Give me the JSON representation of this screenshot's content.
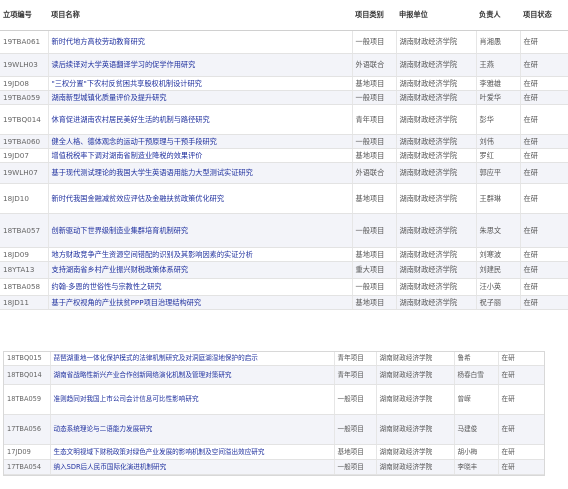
{
  "headers": {
    "id": "立项编号",
    "name": "项目名称",
    "type": "项目类别",
    "unit": "申报单位",
    "person": "负责人",
    "status": "项目状态"
  },
  "rows_main": [
    {
      "id": "19TBA061",
      "name": "新时代地方高校劳动教育研究",
      "type": "一般项目",
      "unit": "湖南财政经济学院",
      "person": "肖湘愚",
      "status": "在研"
    },
    {
      "id": "19WLH03",
      "name": "读后续译对大学英语翻译学习的促学作用研究",
      "type": "外语联合",
      "unit": "湖南财政经济学院",
      "person": "王燕",
      "status": "在研"
    },
    {
      "id": "19JD08",
      "name": "\"三权分置\"下农村反贫困共享股权机制设计研究",
      "type": "基地项目",
      "unit": "湖南财政经济学院",
      "person": "李雅雄",
      "status": "在研"
    },
    {
      "id": "19TBA059",
      "name": "湖南新型城镇化质量评价及提升研究",
      "type": "一般项目",
      "unit": "湖南财政经济学院",
      "person": "叶爱华",
      "status": "在研"
    },
    {
      "id": "19TBQ014",
      "name": "休育促进湖南农村居民美好生活的机制与路径研究",
      "type": "青年项目",
      "unit": "湖南财政经济学院",
      "person": "彭华",
      "status": "在研"
    },
    {
      "id": "19TBA060",
      "name": "健全人格、德体观念的运动干预原理与干预手段研究",
      "type": "一般项目",
      "unit": "湖南财政经济学院",
      "person": "刘伟",
      "status": "在研"
    },
    {
      "id": "19JD07",
      "name": "增值税税率下调对湖南省制造业降税的效果评价",
      "type": "基地项目",
      "unit": "湖南财政经济学院",
      "person": "罗红",
      "status": "在研"
    },
    {
      "id": "19WLH07",
      "name": "基于现代测试理论的我国大学生英语语用能力大型测试实证研究",
      "type": "外语联合",
      "unit": "湖南财政经济学院",
      "person": "郭应平",
      "status": "在研"
    },
    {
      "id": "18JD10",
      "name": "新时代我国金融减贫效应评估及金融扶贫政策优化研究",
      "type": "基地项目",
      "unit": "湖南财政经济学院",
      "person": "王群琳",
      "status": "在研"
    },
    {
      "id": "18TBA057",
      "name": "创新驱动下世界级制造业集群培育机制研究",
      "type": "一般项目",
      "unit": "湖南财政经济学院",
      "person": "朱思文",
      "status": "在研"
    },
    {
      "id": "18JD09",
      "name": "地方财政竞争产生资源空间错配的识别及其影响因素的实证分析",
      "type": "基地项目",
      "unit": "湖南财政经济学院",
      "person": "刘寒波",
      "status": "在研"
    },
    {
      "id": "18YTA13",
      "name": "支持湖南省乡村产业振兴财税政策体系研究",
      "type": "重大项目",
      "unit": "湖南财政经济学院",
      "person": "刘建民",
      "status": "在研"
    },
    {
      "id": "18TBA058",
      "name": "约翰·多恩的世俗性与宗教性之研究",
      "type": "一般项目",
      "unit": "湖南财政经济学院",
      "person": "汪小英",
      "status": "在研"
    },
    {
      "id": "18JD11",
      "name": "基于产权视角的产业扶贫PPP项目治理结构研究",
      "type": "基地项目",
      "unit": "湖南财政经济学院",
      "person": "祝子丽",
      "status": "在研"
    }
  ],
  "rows_overlay": [
    {
      "id": "18TBQ015",
      "name": "琵琶湖重地一体化保护模式的法律机制研究及对洞庭湖湿地保护的启示",
      "type": "青年项目",
      "unit": "湖南财政经济学院",
      "person": "鲁希",
      "status": "在研"
    },
    {
      "id": "18TBQ014",
      "name": "湖南省战略性新兴产业合作创新网络演化机制及管理对策研究",
      "type": "青年项目",
      "unit": "湖南财政经济学院",
      "person": "杨春白雪",
      "status": "在研"
    },
    {
      "id": "18TBA059",
      "name": "准则趋同对我国上市公司会计信息可比性影响研究",
      "type": "一般项目",
      "unit": "湖南财政经济学院",
      "person": "曾嵘",
      "status": "在研"
    },
    {
      "id": "17TBA056",
      "name": "动态系统理论与二语能力发展研究",
      "type": "一般项目",
      "unit": "湖南财政经济学院",
      "person": "马建俊",
      "status": "在研"
    },
    {
      "id": "17JD09",
      "name": "生态文明视域下财税政策对绿色产业发展的影响机制及空间溢出效应研究",
      "type": "基地项目",
      "unit": "湖南财政经济学院",
      "person": "胡小梅",
      "status": "在研"
    },
    {
      "id": "17TBA054",
      "name": "纳入SDR后人民币国际化演进机制研究",
      "type": "一般项目",
      "unit": "湖南财政经济学院",
      "person": "李晓丰",
      "status": "在研"
    }
  ],
  "colors": {
    "link": "#1e2f9e",
    "alt_row": "#f3f4f9",
    "border": "#e3e3e3"
  }
}
